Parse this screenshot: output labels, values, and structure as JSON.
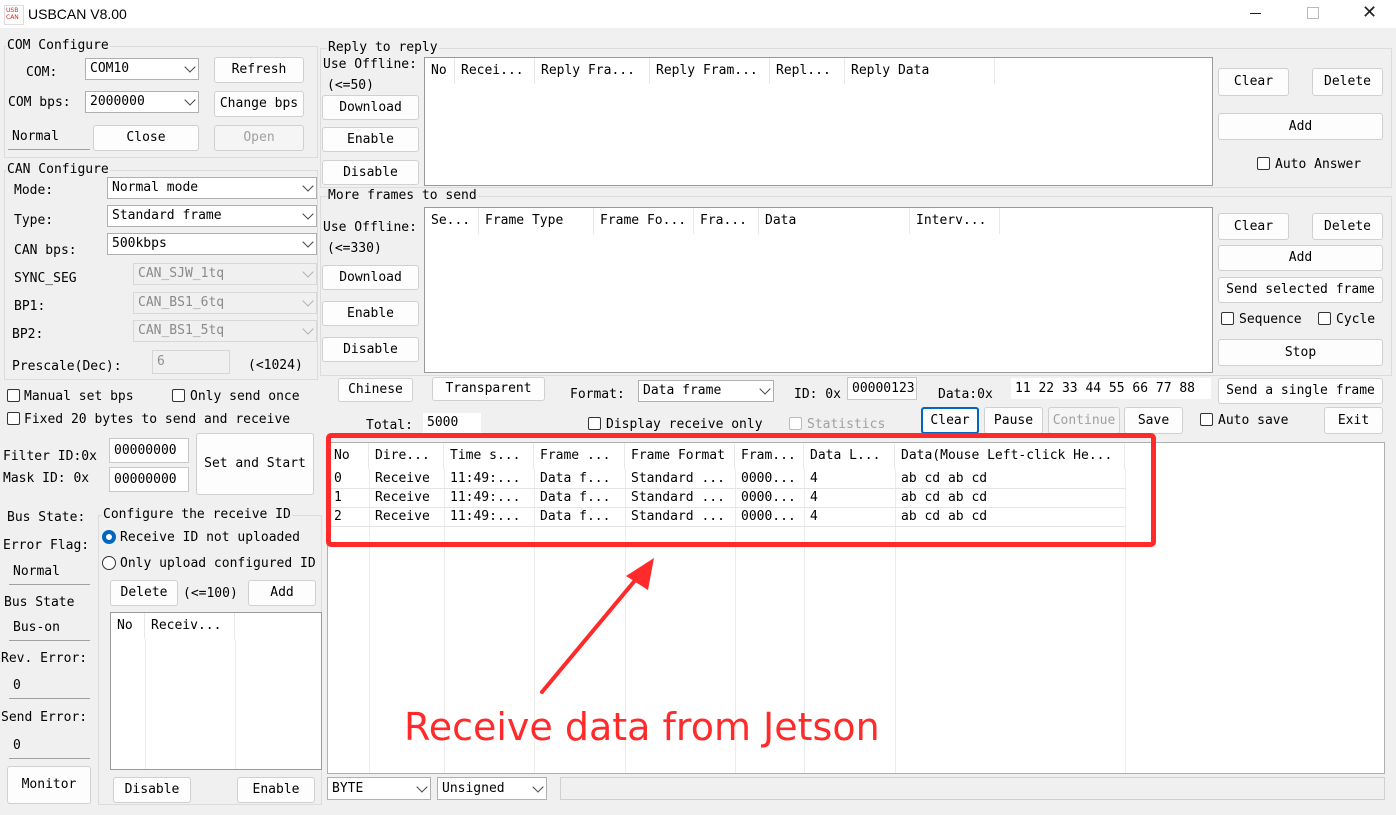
{
  "window": {
    "title": "USBCAN V8.00",
    "logo_text": "USB CAN"
  },
  "com": {
    "group_title": "COM Configure",
    "com_label": "COM:",
    "com_value": "COM10",
    "refresh": "Refresh",
    "bps_label": "COM bps:",
    "bps_value": "2000000",
    "change_bps": "Change bps",
    "status": "Normal",
    "close": "Close",
    "open": "Open"
  },
  "can": {
    "group_title": "CAN Configure",
    "mode_label": "Mode:",
    "mode_value": "Normal mode",
    "type_label": "Type:",
    "type_value": "Standard frame",
    "bps_label": "CAN bps:",
    "bps_value": "500kbps",
    "sync_label": "SYNC_SEG",
    "sync_value": "CAN_SJW_1tq",
    "bp1_label": "BP1:",
    "bp1_value": "CAN_BS1_6tq",
    "bp2_label": "BP2:",
    "bp2_value": "CAN_BS1_5tq",
    "prescale_label": "Prescale(Dec):",
    "prescale_value": "6",
    "prescale_limit": "(<1024)",
    "manual_bps": "Manual set bps",
    "only_send_once": "Only send once",
    "fixed_20": "Fixed 20 bytes to send and receive",
    "filter_label": "Filter ID:0x",
    "filter_value": "00000000",
    "mask_label": "Mask ID:  0x",
    "mask_value": "00000000",
    "set_start": "Set and Start"
  },
  "bus": {
    "state_label": "Bus State:",
    "error_flag_label": "Error Flag:",
    "error_flag_value": "Normal",
    "bus_state_label": "Bus State",
    "bus_state_value": "Bus-on",
    "rev_error_label": "Rev. Error:",
    "rev_error_value": "0",
    "send_error_label": "Send Error:",
    "send_error_value": "0",
    "monitor": "Monitor"
  },
  "receive_id": {
    "group_title": "Configure the receive ID",
    "opt1": "Receive ID not uploaded",
    "opt2": "Only upload configured ID",
    "delete": "Delete",
    "limit": "(<=100)",
    "add": "Add",
    "columns": [
      "No",
      "Receiv..."
    ],
    "disable": "Disable",
    "enable": "Enable"
  },
  "reply": {
    "group_title": "Reply to reply",
    "use_offline": "Use Offline:",
    "limit": "(<=50)",
    "download": "Download",
    "enable": "Enable",
    "disable": "Disable",
    "columns": [
      "No",
      "Recei...",
      "Reply Fra...",
      "Reply Fram...",
      "Repl...",
      "Reply Data"
    ],
    "clear": "Clear",
    "delete": "Delete",
    "add": "Add",
    "auto_answer": "Auto Answer"
  },
  "more_frames": {
    "group_title": "More frames to send",
    "use_offline": "Use Offline:",
    "limit": "(<=330)",
    "download": "Download",
    "enable": "Enable",
    "disable": "Disable",
    "columns": [
      "Se...",
      "Frame Type",
      "Frame Fo...",
      "Fra...",
      "Data",
      "Interv..."
    ],
    "clear": "Clear",
    "delete": "Delete",
    "add": "Add",
    "send_selected": "Send selected frame",
    "sequence": "Sequence",
    "cycle": "Cycle",
    "stop": "Stop"
  },
  "send": {
    "chinese": "Chinese",
    "transparent": "Transparent",
    "format_label": "Format:",
    "format_value": "Data frame",
    "id_label": "ID: 0x",
    "id_value": "00000123",
    "data_label": "Data:0x",
    "data_value": "11 22 33 44 55 66 77 88",
    "send_single": "Send a single frame",
    "total_label": "Total:",
    "total_value": "5000",
    "display_receive_only": "Display receive only",
    "statistics": "Statistics",
    "clear": "Clear",
    "pause": "Pause",
    "continue": "Continue",
    "save": "Save",
    "auto_save": "Auto save",
    "exit": "Exit"
  },
  "receive": {
    "columns": [
      "No",
      "Dire...",
      "Time s...",
      "Frame ...",
      "Frame Format",
      "Fram...",
      "Data L...",
      "Data(Mouse Left-click He..."
    ],
    "rows": [
      [
        "0",
        "Receive",
        "11:49:...",
        "Data f...",
        "Standard ...",
        "0000...",
        "4",
        "ab cd ab cd"
      ],
      [
        "1",
        "Receive",
        "11:49:...",
        "Data f...",
        "Standard ...",
        "0000...",
        "4",
        "ab cd ab cd"
      ],
      [
        "2",
        "Receive",
        "11:49:...",
        "Data f...",
        "Standard ...",
        "0000...",
        "4",
        "ab cd ab cd"
      ]
    ],
    "annotation": "Receive data from Jetson",
    "annotation_color": "#ff2a2a"
  },
  "bottom": {
    "byte_value": "BYTE",
    "sign_value": "Unsigned"
  },
  "colors": {
    "accent": "#0067c0",
    "highlight": "#ff2a2a"
  }
}
